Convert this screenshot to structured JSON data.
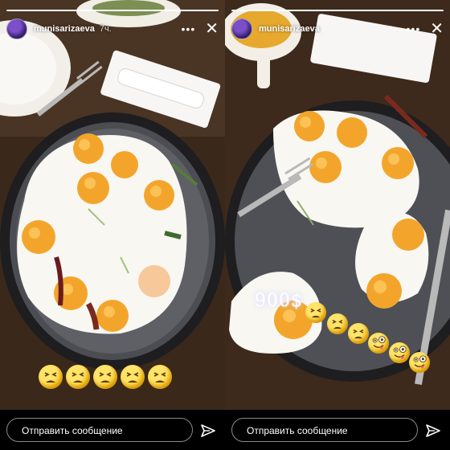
{
  "story": {
    "username": "munisarizaeva",
    "left_time": "7ч.",
    "caption_price": "900$",
    "message_placeholder": "Отправить сообщение"
  },
  "icons": {
    "more": "more-dots-icon",
    "close": "close-icon",
    "send": "send-icon",
    "emoji_tired": "tired-face-emoji",
    "emoji_zany": "zany-face-emoji"
  },
  "progress": {
    "left_fill": 1.0,
    "right_fill": 1.0
  },
  "colors": {
    "background": "#000000",
    "text": "#ffffff",
    "input_border": "#8a8a8a"
  }
}
